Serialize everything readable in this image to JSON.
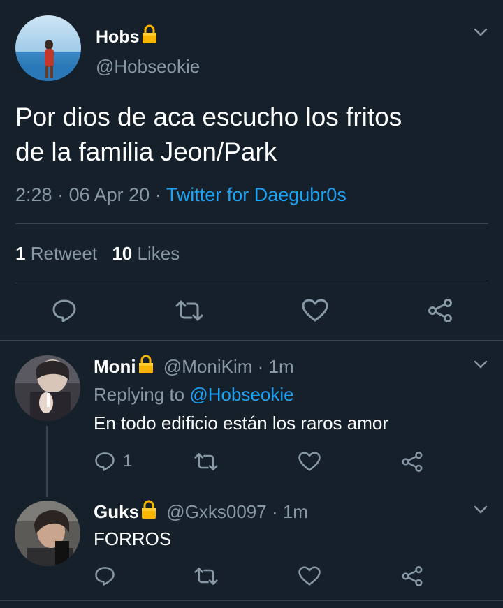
{
  "main_tweet": {
    "display_name": "Hobs",
    "handle": "@Hobseokie",
    "text_line1": "Por dios de aca escucho los fritos",
    "text_line2": "de la familia Jeon/Park",
    "time": "2:28",
    "date": "06 Apr 20",
    "sep": "·",
    "source": "Twitter for Daegubr0s",
    "retweet_count": "1",
    "retweet_label": "Retweet",
    "like_count": "10",
    "like_label": "Likes"
  },
  "replies": [
    {
      "display_name": "Moni",
      "handle": "@MoniKim",
      "time": "· 1m",
      "replying_prefix": "Replying to",
      "replying_handle": "@Hobseokie",
      "text": "En todo edificio están los raros amor",
      "reply_count": "1"
    },
    {
      "display_name": "Guks",
      "handle": "@Gxks0097",
      "time": "· 1m",
      "text": "FORROS"
    }
  ],
  "colors": {
    "background": "#15202b",
    "text": "#ffffff",
    "muted": "#8899a6",
    "link": "#1da1f2",
    "divider": "#38444d",
    "lock": "#f7b500"
  },
  "icons": [
    "lock-icon",
    "chevron-down-icon",
    "reply-icon",
    "retweet-icon",
    "like-icon",
    "share-icon"
  ]
}
